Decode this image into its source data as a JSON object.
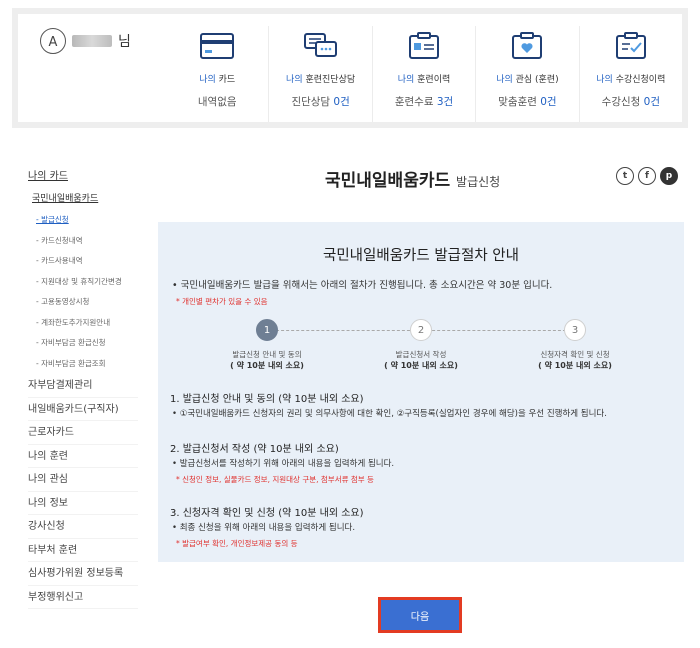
{
  "summary": {
    "user_suffix": "님",
    "items": [
      {
        "title_prefix": "나의 ",
        "title_main": "카드",
        "value_text": "내역없음",
        "value_num": "",
        "value_unit": ""
      },
      {
        "title_prefix": "나의 ",
        "title_main": "훈련진단상담",
        "value_text": "진단상담 ",
        "value_num": "0",
        "value_unit": "건"
      },
      {
        "title_prefix": "나의 ",
        "title_main": "훈련이력",
        "value_text": "훈련수료 ",
        "value_num": "3",
        "value_unit": "건"
      },
      {
        "title_prefix": "나의 ",
        "title_main": "관심 (훈련)",
        "value_text": "맞춤훈련 ",
        "value_num": "0",
        "value_unit": "건"
      },
      {
        "title_prefix": "나의 ",
        "title_main": "수강신청이력",
        "value_text": "수강신청 ",
        "value_num": "0",
        "value_unit": "건"
      }
    ]
  },
  "sidebar": {
    "top": "나의 카드",
    "sub": "국민내일배움카드",
    "subsub": [
      "- 발급신청",
      "- 카드신청내역",
      "- 카드사용내역",
      "- 지원대상 및 휴직기간변경",
      "- 고용동영상시청",
      "- 계좌한도추가지원안내",
      "- 자비부담금 환급신청",
      "- 자비부담금 환급조회"
    ],
    "main": [
      "자부담결제관리",
      "내일배움카드(구직자)",
      "근로자카드",
      "나의 훈련",
      "나의 관심",
      "나의 정보",
      "강사신청",
      "타부처 훈련",
      "심사평가위원 정보등록",
      "부정행위신고"
    ]
  },
  "page": {
    "title": "국민내일배움카드",
    "title_sub": "발급신청",
    "share": [
      "t",
      "f",
      "p"
    ]
  },
  "panel": {
    "title": "국민내일배움카드 발급절차 안내",
    "intro": "• 국민내일배움카드 발급을 위해서는 아래의 절차가 진행됩니다. 총 소요시간은 약 30분 입니다.",
    "intro_note": "* 개인별 편차가 있을 수 있음",
    "steps": [
      {
        "num": "1",
        "label": "발급신청 안내 및 동의",
        "duration": "( 약 10분 내외 소요)"
      },
      {
        "num": "2",
        "label": "발급신청서 작성",
        "duration": "( 약 10분 내외 소요)"
      },
      {
        "num": "3",
        "label": "신청자격 확인 및 신청",
        "duration": "( 약 10분 내외 소요)"
      }
    ],
    "sections": [
      {
        "title": "1. 발급신청 안내 및 동의 (약 10분 내외 소요)",
        "text": "• ①국민내일배움카드 신청자의 권리 및 의무사항에 대한 확인, ②구직등록(실업자인 경우에 해당)을 우선 진행하게 됩니다.",
        "note": ""
      },
      {
        "title": "2. 발급신청서 작성 (약 10분 내외 소요)",
        "text": "• 발급신청서를 작성하기 위해 아래의 내용을 입력하게 됩니다.",
        "note": "* 신청인 정보, 실물카드 정보, 지원대상 구분, 첨부서류 첨부 등"
      },
      {
        "title": "3. 신청자격 확인 및 신청 (약 10분 내외 소요)",
        "text": "• 최종 신청을 위해 아래의 내용을 입력하게 됩니다.",
        "note": "* 발급여부 확인, 개인정보제공 동의 등"
      }
    ]
  },
  "next_button": "다음",
  "colors": {
    "accent": "#1f5fc2",
    "button": "#3a6fd2",
    "button_border": "#e33b22",
    "note": "#e0302d",
    "panel_bg": "#e9f0f8"
  }
}
